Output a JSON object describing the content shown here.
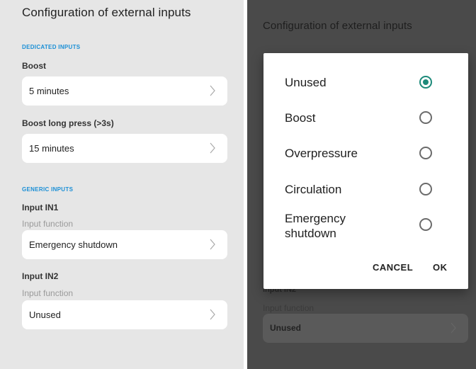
{
  "left_screen": {
    "title": "Configuration of external inputs",
    "dedicated_section": "DEDICATED INPUTS",
    "boost_label": "Boost",
    "boost_value": "5 minutes",
    "boost_long_label": "Boost long press (>3s)",
    "boost_long_value": "15 minutes",
    "generic_section": "GENERIC INPUTS",
    "in1_label": "Input IN1",
    "in1_sublabel": "Input function",
    "in1_value": "Emergency shutdown",
    "in2_label": "Input IN2",
    "in2_sublabel": "Input function",
    "in2_value": "Unused"
  },
  "right_screen": {
    "title": "Configuration of external inputs",
    "in2_label": "Input IN2",
    "in2_sublabel": "Input function",
    "in2_value": "Unused",
    "dialog": {
      "options": [
        {
          "label": "Unused",
          "selected": true
        },
        {
          "label": "Boost",
          "selected": false
        },
        {
          "label": "Overpressure",
          "selected": false
        },
        {
          "label": "Circulation",
          "selected": false
        },
        {
          "label": "Emergency shutdown",
          "selected": false
        }
      ],
      "cancel_label": "CANCEL",
      "ok_label": "OK"
    }
  },
  "colors": {
    "accent_blue": "#1a8fd6",
    "radio_selected": "#1d8a7a",
    "overlay": "#4a4a4a"
  }
}
